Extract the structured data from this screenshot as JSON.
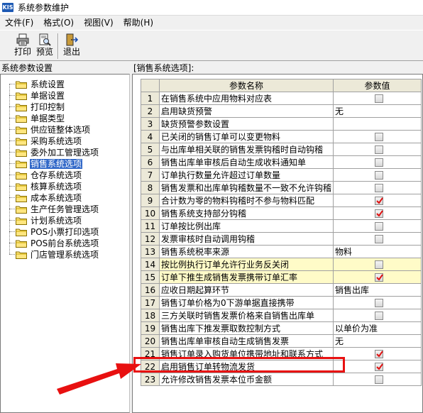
{
  "window": {
    "logo_text": "KIS",
    "title": "系统参数维护"
  },
  "menu": [
    "文件(F)",
    "格式(O)",
    "视图(V)",
    "帮助(H)"
  ],
  "toolbar": {
    "print": "打印",
    "preview": "预览",
    "exit": "退出"
  },
  "left_panel": {
    "header": "系统参数设置",
    "items": [
      "系统设置",
      "单据设置",
      "打印控制",
      "单据类型",
      "供应链整体选项",
      "采购系统选项",
      "委外加工管理选项",
      "销售系统选项",
      "仓存系统选项",
      "核算系统选项",
      "成本系统选项",
      "生产任务管理选项",
      "计划系统选项",
      "POS小票打印选项",
      "POS前台系统选项",
      "门店管理系统选项"
    ],
    "selected": "销售系统选项"
  },
  "right_panel": {
    "header": "[销售系统选项]:",
    "columns": [
      "参数名称",
      "参数值"
    ],
    "rows": [
      {
        "n": "1",
        "name": "在销售系统中应用物料对应表",
        "type": "check",
        "checked": false
      },
      {
        "n": "2",
        "name": "启用缺货预警",
        "type": "text",
        "value": "无"
      },
      {
        "n": "3",
        "name": "缺货预警参数设置",
        "type": "none"
      },
      {
        "n": "4",
        "name": "已关闭的销售订单可以变更物料",
        "type": "check",
        "checked": false
      },
      {
        "n": "5",
        "name": "与出库单相关联的销售发票钩稽时自动钩稽",
        "type": "check",
        "checked": false
      },
      {
        "n": "6",
        "name": "销售出库单审核后自动生成收料通知单",
        "type": "check",
        "checked": false
      },
      {
        "n": "7",
        "name": "订单执行数量允许超过订单数量",
        "type": "check",
        "checked": false
      },
      {
        "n": "8",
        "name": "销售发票和出库单钩稽数量不一致不允许钩稽",
        "type": "check",
        "checked": false
      },
      {
        "n": "9",
        "name": "合计数为零的物料钩稽时不参与物料匹配",
        "type": "check",
        "checked": true
      },
      {
        "n": "10",
        "name": "销售系统支持部分钩稽",
        "type": "check",
        "checked": true
      },
      {
        "n": "11",
        "name": "订单按比例出库",
        "type": "check",
        "checked": false
      },
      {
        "n": "12",
        "name": "发票审核时自动调用钩稽",
        "type": "check",
        "checked": false
      },
      {
        "n": "13",
        "name": "销售系统税率来源",
        "type": "text",
        "value": "物料"
      },
      {
        "n": "14",
        "name": "按比例执行订单允许行业务反关闭",
        "type": "check",
        "checked": false,
        "highlight": true
      },
      {
        "n": "15",
        "name": "订单下推生成销售发票携带订单汇率",
        "type": "check",
        "checked": true,
        "highlight": true
      },
      {
        "n": "16",
        "name": "应收日期起算环节",
        "type": "text",
        "value": "销售出库"
      },
      {
        "n": "17",
        "name": "销售订单价格为0下游单据直接携带",
        "type": "check",
        "checked": false
      },
      {
        "n": "18",
        "name": "三方关联时销售发票价格来自销售出库单",
        "type": "check",
        "checked": false
      },
      {
        "n": "19",
        "name": "销售出库下推发票取数控制方式",
        "type": "text",
        "value": "以单价为准"
      },
      {
        "n": "20",
        "name": "销售出库单审核自动生成销售发票",
        "type": "text",
        "value": "无"
      },
      {
        "n": "21",
        "name": "销售订单录入购货单位携带地址和联系方式",
        "type": "check",
        "checked": true
      },
      {
        "n": "22",
        "name": "启用销售订单转物流发货",
        "type": "check",
        "checked": true
      },
      {
        "n": "23",
        "name": "允许修改销售发票本位币金额",
        "type": "check",
        "checked": false
      }
    ]
  },
  "colors": {
    "selection": "#3168c8",
    "highlight_row": "#fffbc8",
    "annotation_red": "#e81010"
  }
}
